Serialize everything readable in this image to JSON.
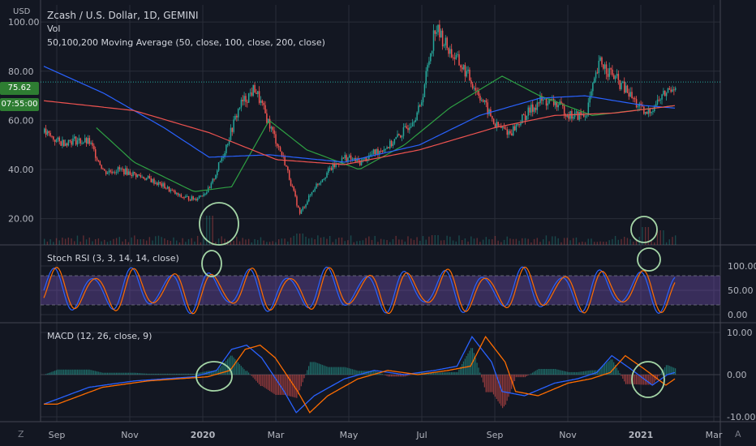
{
  "symbol_title": "Zcash / U.S. Dollar, 1D, GEMINI",
  "vol_label": "Vol",
  "ma_label": "50,100,200 Moving Average (50, close, 100, close, 200, close)",
  "stoch_label": "Stoch RSI (3, 3, 14, 14, close)",
  "macd_label": "MACD (12, 26, close, 9)",
  "currency_label": "USD",
  "last_price": "75.62",
  "countdown": "07:55:00",
  "corner_left": "Z",
  "corner_right": "A",
  "colors": {
    "background": "#131722",
    "grid": "#2a2e39",
    "up": "#26a69a",
    "down": "#ef5350",
    "ma50": "#2ea043",
    "ma100": "#2962ff",
    "ma200": "#ef5350",
    "stoch_k": "#2962ff",
    "stoch_d": "#ff6d00",
    "stoch_band": "#7e57c2",
    "macd": "#2962ff",
    "signal": "#ff6d00",
    "annotation": "#a5d6a7"
  },
  "chart_data": [
    {
      "type": "candlestick",
      "title": "Zcash / U.S. Dollar, 1D, GEMINI",
      "y_ticks": [
        "100.00",
        "80.00",
        "60.00",
        "40.00",
        "20.00"
      ],
      "x_ticks": [
        "Sep",
        "Nov",
        "2020",
        "Mar",
        "May",
        "Jul",
        "Sep",
        "Nov",
        "2021",
        "Mar"
      ],
      "ylim": [
        10,
        105
      ],
      "price_path": [
        [
          0,
          55
        ],
        [
          10,
          51
        ],
        [
          20,
          52
        ],
        [
          30,
          51
        ],
        [
          40,
          39
        ],
        [
          50,
          40
        ],
        [
          60,
          38
        ],
        [
          70,
          36
        ],
        [
          80,
          33
        ],
        [
          90,
          29
        ],
        [
          100,
          28
        ],
        [
          110,
          32
        ],
        [
          120,
          48
        ],
        [
          130,
          66
        ],
        [
          140,
          73
        ],
        [
          150,
          58
        ],
        [
          160,
          43
        ],
        [
          170,
          22
        ],
        [
          180,
          33
        ],
        [
          190,
          40
        ],
        [
          200,
          45
        ],
        [
          210,
          43
        ],
        [
          220,
          47
        ],
        [
          230,
          50
        ],
        [
          240,
          56
        ],
        [
          250,
          65
        ],
        [
          260,
          98
        ],
        [
          270,
          88
        ],
        [
          280,
          80
        ],
        [
          290,
          70
        ],
        [
          300,
          58
        ],
        [
          310,
          55
        ],
        [
          320,
          62
        ],
        [
          330,
          68
        ],
        [
          340,
          67
        ],
        [
          350,
          62
        ],
        [
          360,
          62
        ],
        [
          370,
          84
        ],
        [
          380,
          77
        ],
        [
          390,
          70
        ],
        [
          400,
          62
        ],
        [
          410,
          69
        ],
        [
          420,
          75
        ]
      ],
      "ma_series": [
        {
          "name": "MA 50",
          "values": [
            [
              35,
              57
            ],
            [
              60,
              43
            ],
            [
              100,
              31
            ],
            [
              125,
              33
            ],
            [
              150,
              60
            ],
            [
              175,
              48
            ],
            [
              210,
              40
            ],
            [
              240,
              50
            ],
            [
              270,
              65
            ],
            [
              305,
              78
            ],
            [
              330,
              70
            ],
            [
              365,
              62
            ],
            [
              420,
              66
            ]
          ]
        },
        {
          "name": "MA 100",
          "values": [
            [
              0,
              82
            ],
            [
              40,
              71
            ],
            [
              80,
              57
            ],
            [
              110,
              45
            ],
            [
              150,
              46
            ],
            [
              200,
              43
            ],
            [
              250,
              50
            ],
            [
              290,
              62
            ],
            [
              330,
              69
            ],
            [
              360,
              70
            ],
            [
              400,
              66
            ],
            [
              420,
              65
            ]
          ]
        },
        {
          "name": "MA 200",
          "values": [
            [
              0,
              68
            ],
            [
              60,
              64
            ],
            [
              110,
              55
            ],
            [
              155,
              44
            ],
            [
              200,
              42
            ],
            [
              250,
              48
            ],
            [
              300,
              57
            ],
            [
              340,
              62
            ],
            [
              380,
              63
            ],
            [
              420,
              66
            ]
          ]
        }
      ],
      "volume_spikes": [
        [
          110,
          0.9
        ],
        [
          170,
          0.35
        ],
        [
          260,
          0.3
        ],
        [
          400,
          0.55
        ],
        [
          410,
          0.45
        ]
      ]
    },
    {
      "type": "line",
      "title": "Stoch RSI (3, 3, 14, 14, close)",
      "y_ticks": [
        "100.00",
        "50.00",
        "0.00"
      ],
      "ylim": [
        0,
        100
      ],
      "bands": [
        20,
        80
      ],
      "cycle_days": 26,
      "series": [
        {
          "name": "K"
        },
        {
          "name": "D"
        }
      ]
    },
    {
      "type": "line",
      "title": "MACD (12, 26, close, 9)",
      "y_ticks": [
        "10.00",
        "0.00",
        "-10.00"
      ],
      "ylim": [
        -10.5,
        10.5
      ],
      "macd_path": [
        [
          0,
          -7
        ],
        [
          30,
          -3
        ],
        [
          60,
          -1.5
        ],
        [
          100,
          -0.5
        ],
        [
          115,
          1
        ],
        [
          125,
          6
        ],
        [
          135,
          7
        ],
        [
          145,
          4
        ],
        [
          160,
          -4
        ],
        [
          168,
          -9
        ],
        [
          180,
          -5
        ],
        [
          200,
          -1
        ],
        [
          220,
          1
        ],
        [
          240,
          0
        ],
        [
          260,
          1
        ],
        [
          275,
          2
        ],
        [
          285,
          9
        ],
        [
          298,
          3
        ],
        [
          305,
          -4
        ],
        [
          320,
          -5
        ],
        [
          340,
          -2
        ],
        [
          355,
          -1
        ],
        [
          368,
          0.5
        ],
        [
          378,
          4.5
        ],
        [
          390,
          1.5
        ],
        [
          405,
          -2.5
        ],
        [
          415,
          0
        ],
        [
          420,
          0.5
        ]
      ],
      "series": [
        {
          "name": "MACD"
        },
        {
          "name": "Signal"
        },
        {
          "name": "Histogram"
        }
      ]
    }
  ]
}
